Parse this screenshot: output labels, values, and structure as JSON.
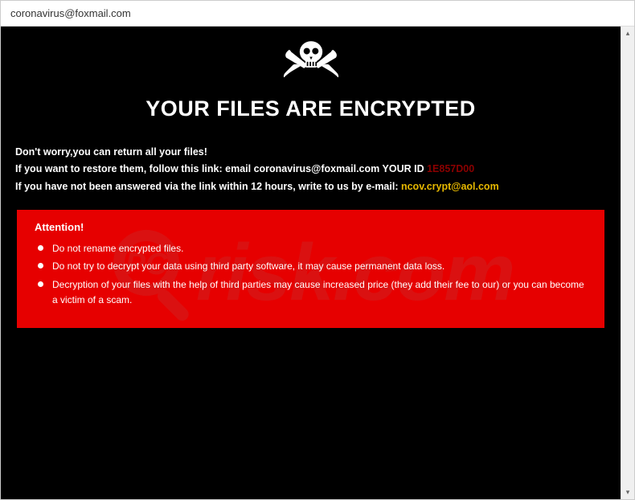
{
  "window": {
    "title": "coronavirus@foxmail.com"
  },
  "header": {
    "headline": "YOUR FILES ARE ENCRYPTED"
  },
  "intro": {
    "line1": "Don't worry,you can return all your files!",
    "line2_pre": "If you want to restore them, follow this link: ",
    "line2_email_label": "email ",
    "email1": "coronavirus@foxmail.com",
    "line2_id_label": "  YOUR ID ",
    "id_value": "1E857D00",
    "line3_pre": "If you have not been answered via the link within 12 hours, write to us by e-mail: ",
    "email2": "ncov.crypt@aol.com"
  },
  "attention": {
    "title": "Attention!",
    "items": [
      "Do not rename encrypted files.",
      "Do not try to decrypt your data using third party software, it may cause permanent data loss.",
      "Decryption of your files with the help of third parties may cause increased price (they add their fee to our) or you can become a victim of a scam."
    ]
  },
  "watermark": {
    "text": "risk.com"
  },
  "scroll": {
    "up": "▴",
    "down": "▾"
  }
}
